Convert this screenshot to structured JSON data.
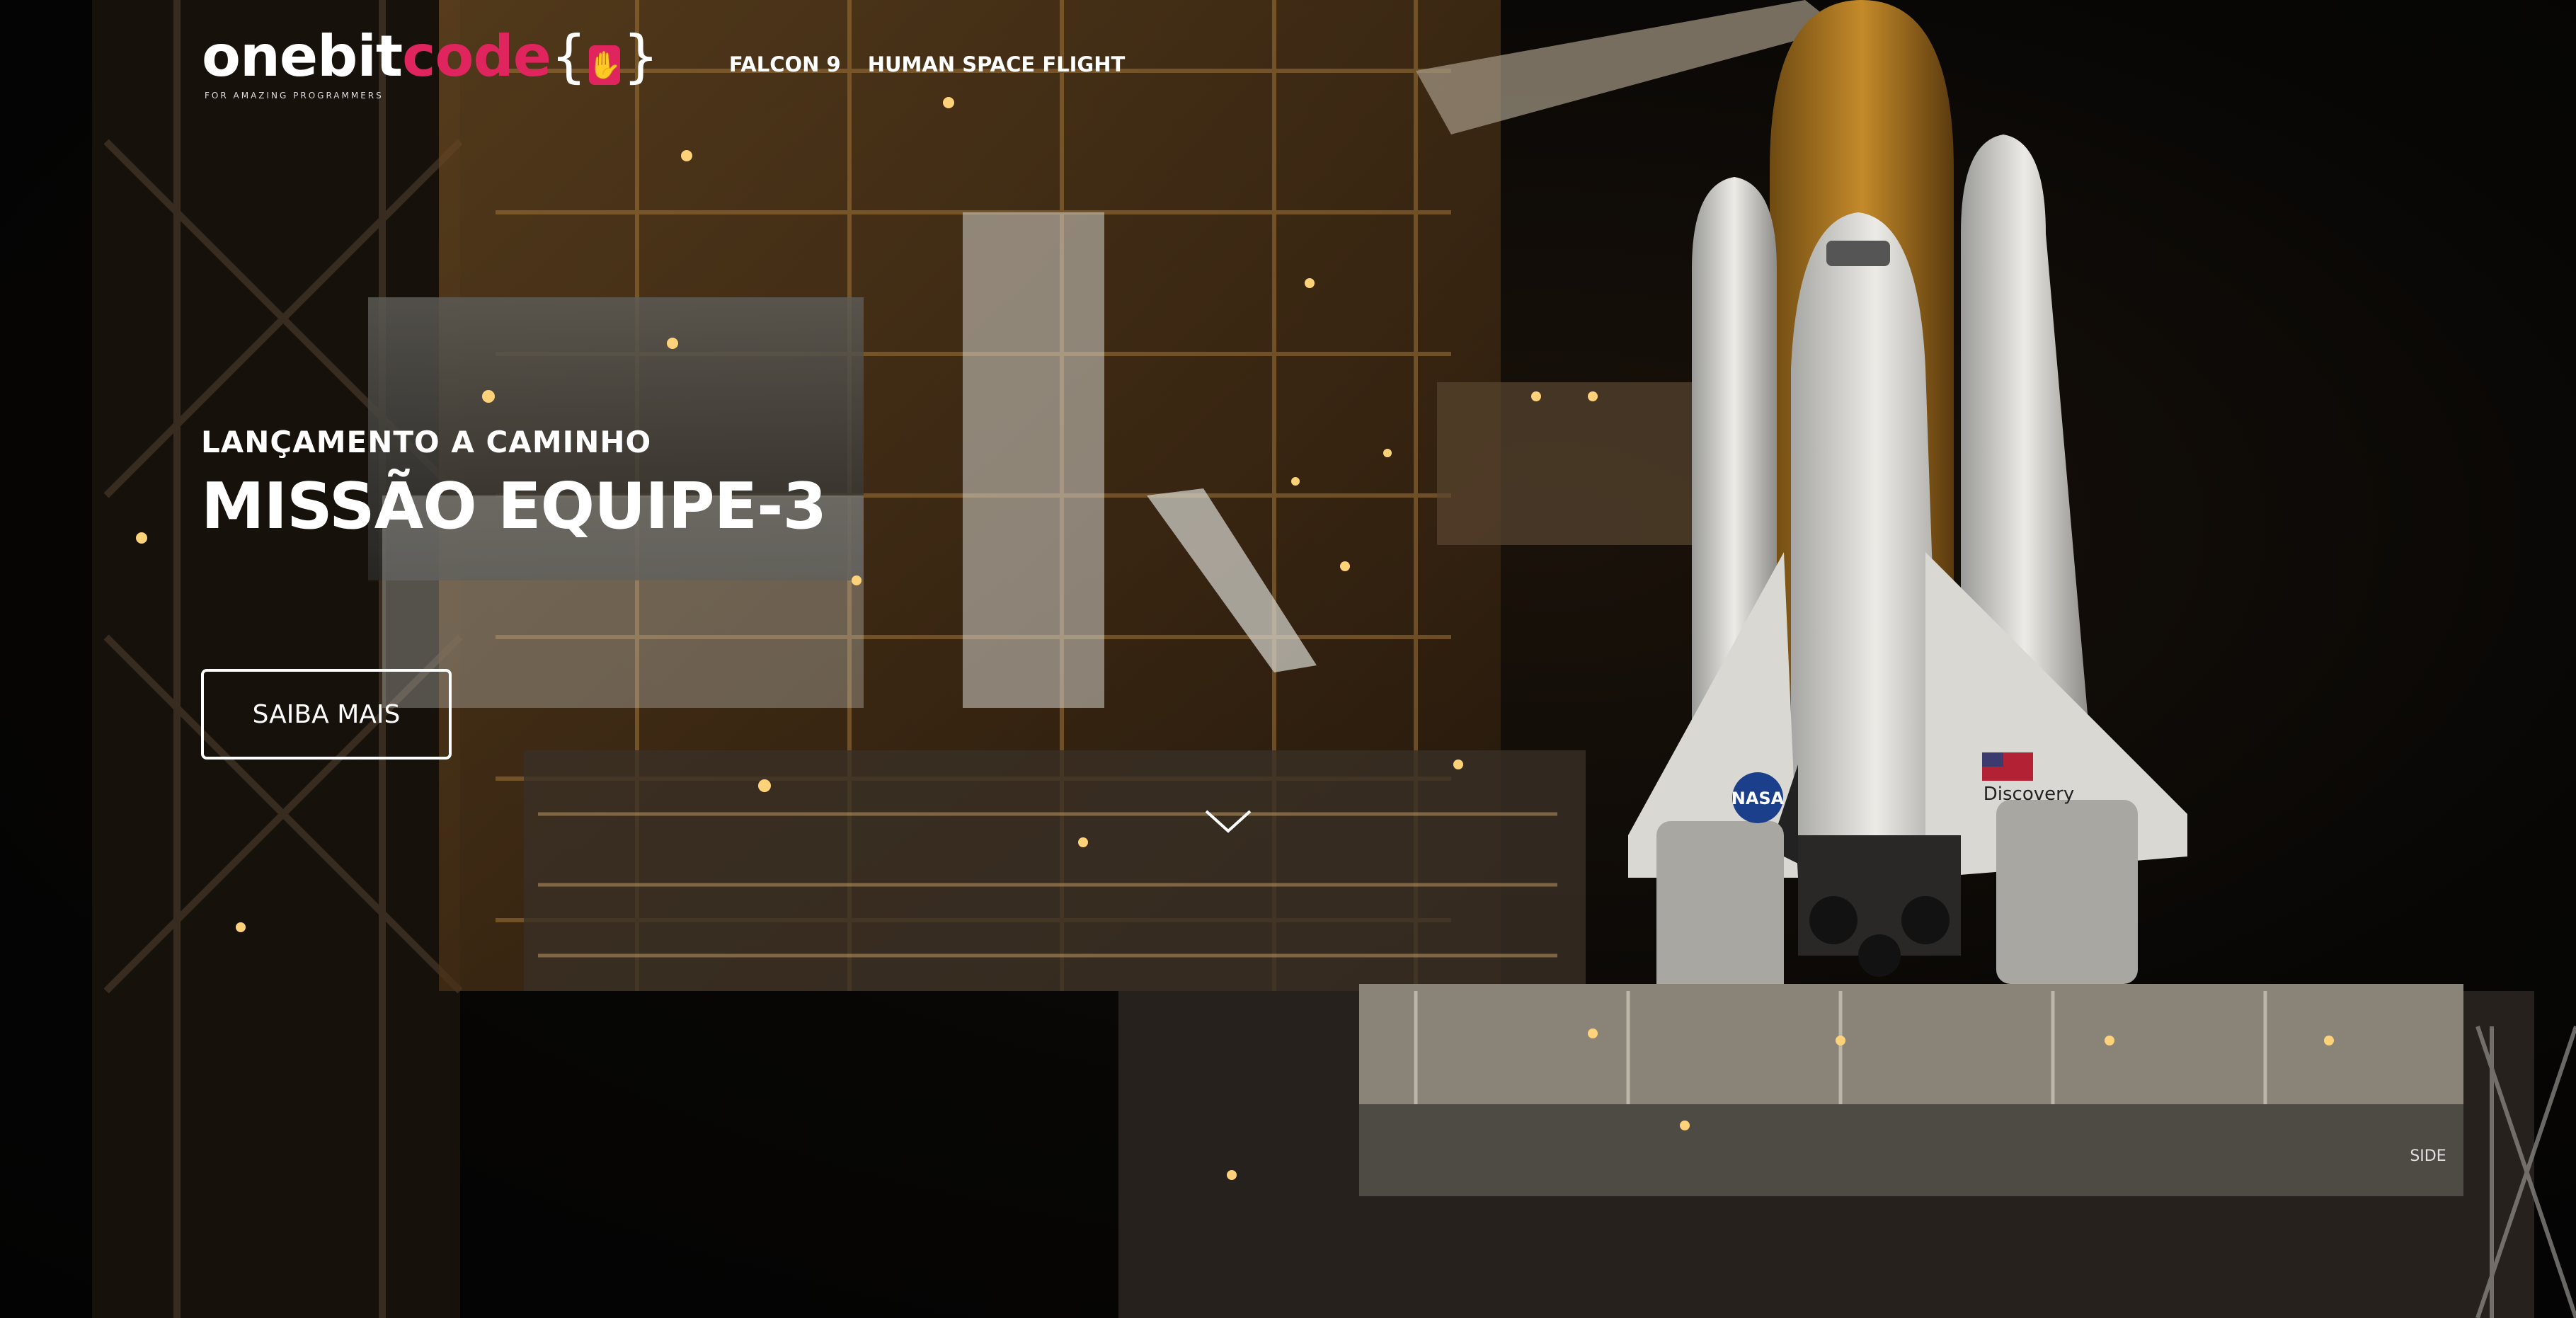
{
  "logo": {
    "part1": "onebit",
    "part2": "code",
    "brace_open": "{",
    "brace_close": "}",
    "tagline": "FOR AMAZING PROGRAMMERS"
  },
  "nav": {
    "items": [
      {
        "label": "FALCON 9"
      },
      {
        "label": "HUMAN SPACE FLIGHT"
      }
    ]
  },
  "hero": {
    "subtitle": "LANÇAMENTO A CAMINHO",
    "title": "MISSÃO EQUIPE-3",
    "button_label": "SAIBA MAIS",
    "shuttle_name": "Discovery",
    "agency_badge": "NASA",
    "pad_side_label": "SIDE"
  },
  "colors": {
    "brand_pink": "#e0245e",
    "text": "#ffffff",
    "background": "#050505"
  },
  "icons": {
    "scroll": "chevron-down-icon",
    "logo_mark": "rock-hand-icon"
  }
}
